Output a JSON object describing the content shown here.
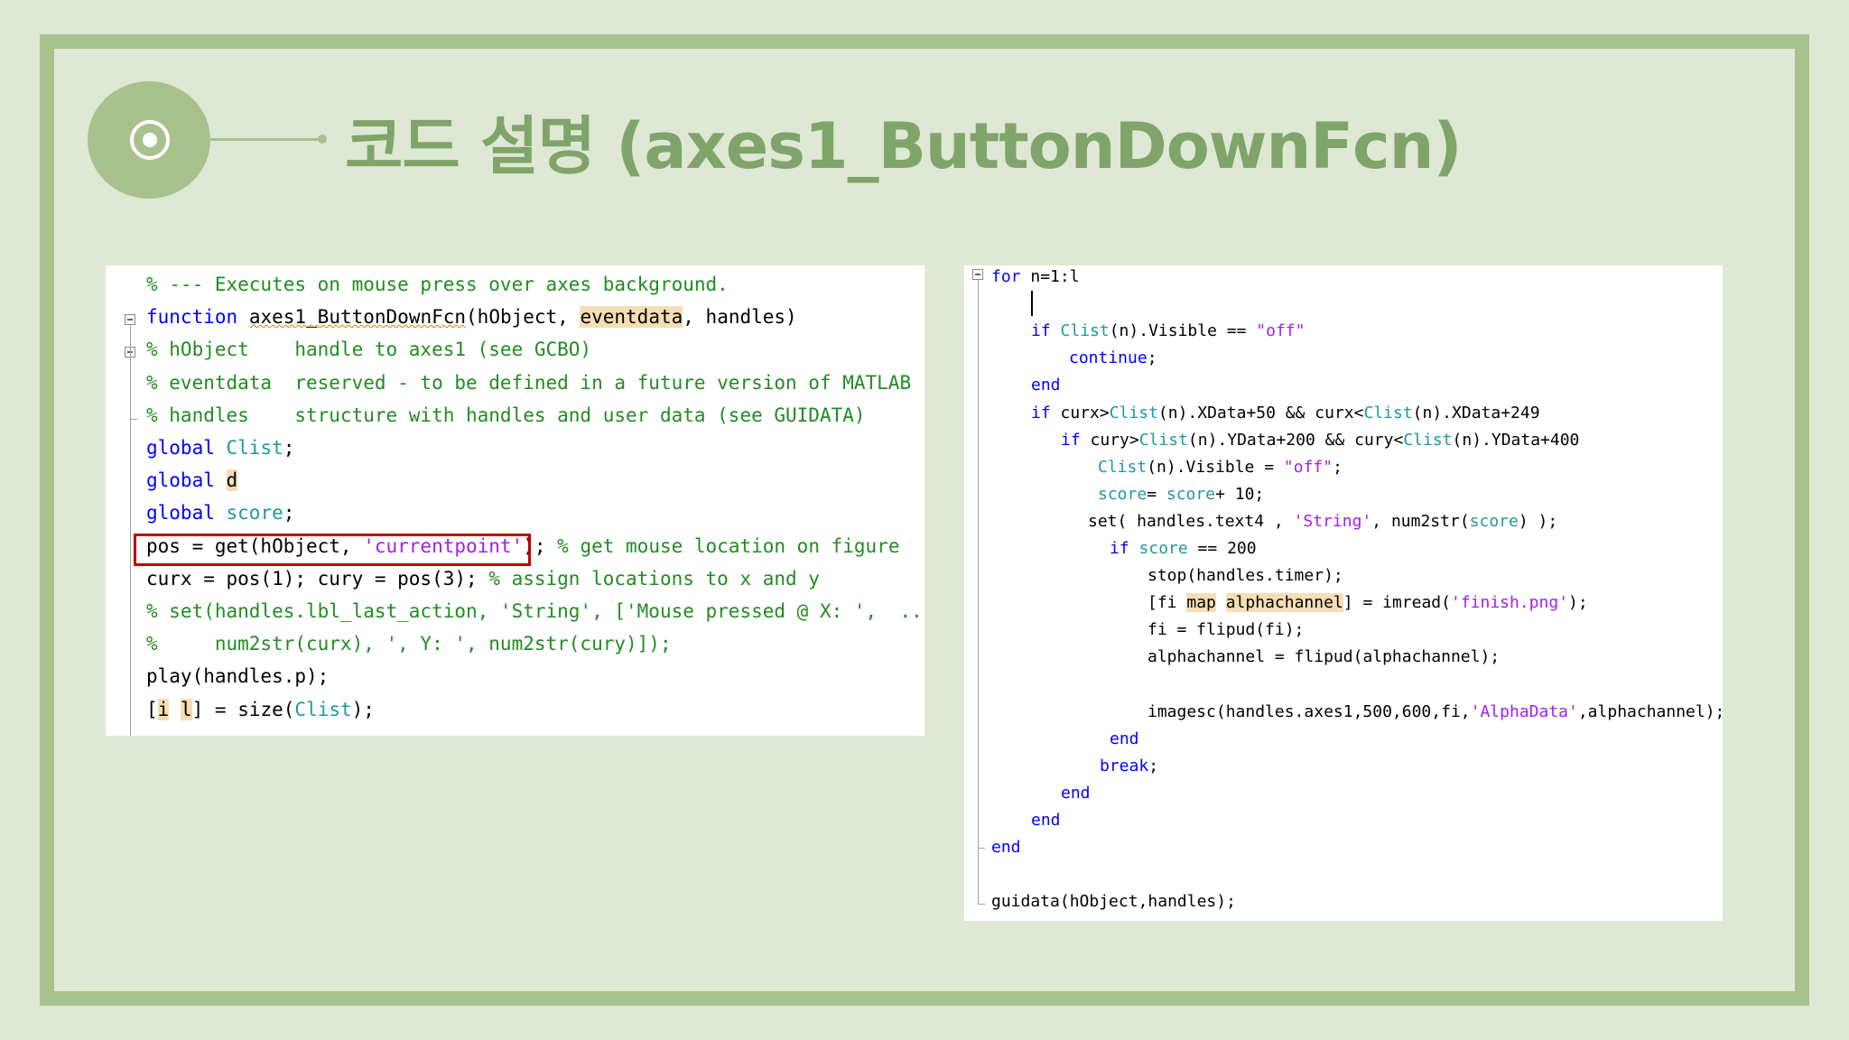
{
  "slide": {
    "title": "코드 설명 (axes1_ButtonDownFcn)",
    "colors": {
      "accent": "#a8c28e",
      "title": "#7fa56a",
      "background": "#dfe8d4"
    },
    "icon": "target-icon"
  },
  "left_code": [
    [
      [
        "c-com",
        "% --- Executes on mouse press over axes background."
      ]
    ],
    [
      [
        "c-kw",
        "function"
      ],
      [
        "",
        " "
      ],
      [
        "c-err",
        "axes1_ButtonDownFcn"
      ],
      [
        "",
        "(hObject, "
      ],
      [
        "c-hl",
        "eventdata"
      ],
      [
        "",
        ", handles)"
      ]
    ],
    [
      [
        "c-com",
        "% hObject    handle to axes1 (see GCBO)"
      ]
    ],
    [
      [
        "c-com",
        "% eventdata  reserved - to be defined in a future version of MATLAB"
      ]
    ],
    [
      [
        "c-com",
        "% handles    structure with handles and user data (see GUIDATA)"
      ]
    ],
    [
      [
        "c-kw",
        "global"
      ],
      [
        "",
        " "
      ],
      [
        "c-var",
        "Clist"
      ],
      [
        "",
        ";"
      ]
    ],
    [
      [
        "c-kw",
        "global"
      ],
      [
        "",
        " "
      ],
      [
        "c-hl",
        "d"
      ]
    ],
    [
      [
        "c-kw",
        "global"
      ],
      [
        "",
        " "
      ],
      [
        "c-var",
        "score"
      ],
      [
        "",
        ";"
      ]
    ],
    [
      [
        "",
        "pos = get(hObject, "
      ],
      [
        "c-str",
        "'currentpoint'"
      ],
      [
        "",
        "); "
      ],
      [
        "c-com",
        "% get mouse location on figure"
      ]
    ],
    [
      [
        "",
        "curx = pos(1); cury = pos(3); "
      ],
      [
        "c-com",
        "% assign locations to x and y"
      ]
    ],
    [
      [
        "c-com",
        "% set(handles.lbl_last_action, 'String', ['Mouse pressed @ X: ',  ..."
      ]
    ],
    [
      [
        "c-com",
        "%     num2str(curx), ', Y: ', num2str(cury)]);"
      ]
    ],
    [
      [
        "",
        "play(handles.p);"
      ]
    ],
    [
      [
        "",
        "["
      ],
      [
        "c-hl",
        "i"
      ],
      [
        "",
        " "
      ],
      [
        "c-hl",
        "l"
      ],
      [
        "",
        "] = size("
      ],
      [
        "c-var",
        "Clist"
      ],
      [
        "",
        ");"
      ]
    ]
  ],
  "right_code": [
    [
      [
        "c-kw",
        "for"
      ],
      [
        "",
        " n=1:l"
      ]
    ],
    [
      [
        "",
        ""
      ]
    ],
    [
      [
        "c-kw",
        "if"
      ],
      [
        "",
        " "
      ],
      [
        "c-var",
        "Clist"
      ],
      [
        "",
        "(n).Visible == "
      ],
      [
        "c-str",
        "\"off\""
      ]
    ],
    [
      [
        "c-kw",
        "continue"
      ],
      [
        "",
        ";"
      ]
    ],
    [
      [
        "c-kw",
        "end"
      ]
    ],
    [
      [
        "c-kw",
        "if"
      ],
      [
        "",
        " curx>"
      ],
      [
        "c-var",
        "Clist"
      ],
      [
        "",
        "(n).XData+50 && curx<"
      ],
      [
        "c-var",
        "Clist"
      ],
      [
        "",
        "(n).XData+249"
      ]
    ],
    [
      [
        "c-kw",
        "if"
      ],
      [
        "",
        " cury>"
      ],
      [
        "c-var",
        "Clist"
      ],
      [
        "",
        "(n).YData+200 && cury<"
      ],
      [
        "c-var",
        "Clist"
      ],
      [
        "",
        "(n).YData+400"
      ]
    ],
    [
      [
        "c-var",
        "Clist"
      ],
      [
        "",
        "(n).Visible = "
      ],
      [
        "c-str",
        "\"off\""
      ],
      [
        "",
        ";"
      ]
    ],
    [
      [
        "c-var",
        "score"
      ],
      [
        "",
        "= "
      ],
      [
        "c-var",
        "score"
      ],
      [
        "",
        "+ 10;"
      ]
    ],
    [
      [
        "",
        "set( handles.text4 , "
      ],
      [
        "c-str",
        "'String'"
      ],
      [
        "",
        ", num2str("
      ],
      [
        "c-var",
        "score"
      ],
      [
        "",
        ") );"
      ]
    ],
    [
      [
        "c-kw",
        "if"
      ],
      [
        "",
        " "
      ],
      [
        "c-var",
        "score"
      ],
      [
        "",
        " == 200"
      ]
    ],
    [
      [
        "",
        "stop(handles.timer);"
      ]
    ],
    [
      [
        "",
        "[fi "
      ],
      [
        "c-hl",
        "map"
      ],
      [
        "",
        " "
      ],
      [
        "c-hl",
        "alphachannel"
      ],
      [
        "",
        "] = imread("
      ],
      [
        "c-str",
        "'finish.png'"
      ],
      [
        "",
        ");"
      ]
    ],
    [
      [
        "",
        "fi = flipud(fi);"
      ]
    ],
    [
      [
        "",
        "alphachannel = flipud(alphachannel);"
      ]
    ],
    [
      [
        "",
        ""
      ]
    ],
    [
      [
        "",
        "imagesc(handles.axes1,500,600,fi,"
      ],
      [
        "c-str",
        "'AlphaData'"
      ],
      [
        "",
        ",alphachannel);"
      ]
    ],
    [
      [
        "c-kw",
        "end"
      ]
    ],
    [
      [
        "c-kw",
        "break"
      ],
      [
        "",
        ";"
      ]
    ],
    [
      [
        "c-kw",
        "end"
      ]
    ],
    [
      [
        "c-kw",
        "end"
      ]
    ],
    [
      [
        "c-kw",
        "end"
      ]
    ],
    [
      [
        "",
        ""
      ]
    ],
    [
      [
        "",
        "guidata(hObject,handles);"
      ]
    ]
  ]
}
